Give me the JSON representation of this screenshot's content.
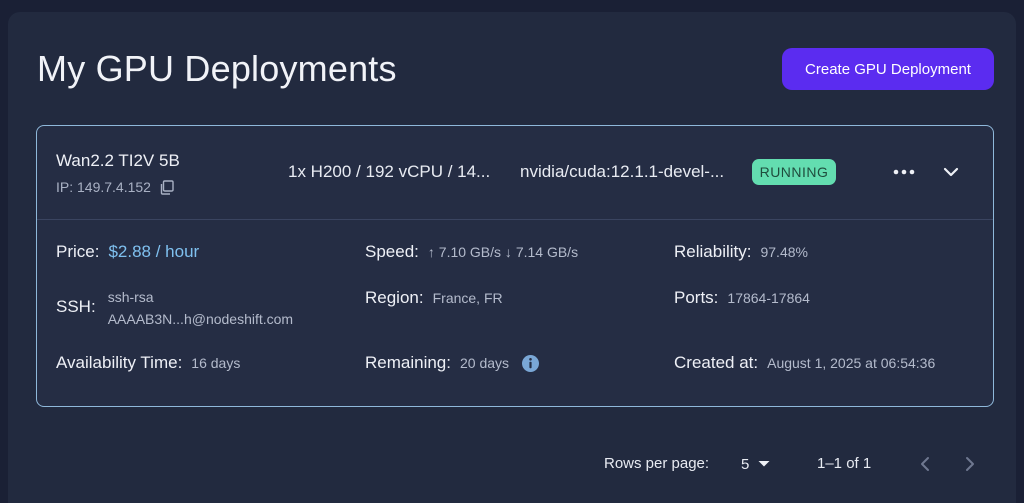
{
  "header": {
    "title": "My GPU Deployments",
    "create_button_label": "Create GPU Deployment"
  },
  "deployment": {
    "name": "Wan2.2 TI2V 5B",
    "ip": "IP: 149.7.4.152",
    "specs": "1x H200 / 192 vCPU / 14...",
    "image": "nvidia/cuda:12.1.1-devel-...",
    "status": "RUNNING",
    "details": {
      "price_label": "Price:",
      "price_value": "$2.88 / hour",
      "speed_label": "Speed:",
      "speed_value": "↑ 7.10 GB/s ↓ 7.14 GB/s",
      "reliability_label": "Reliability:",
      "reliability_value": "97.48%",
      "ssh_label": "SSH:",
      "ssh_line1": "ssh-rsa",
      "ssh_line2": "AAAAB3N...h@nodeshift.com",
      "region_label": "Region:",
      "region_value": "France, FR",
      "ports_label": "Ports:",
      "ports_value": "17864-17864",
      "availability_label": "Availability Time:",
      "availability_value": "16 days",
      "remaining_label": "Remaining:",
      "remaining_value": "20 days",
      "created_label": "Created at:",
      "created_value": "August 1, 2025 at 06:54:36"
    }
  },
  "pagination": {
    "rows_per_page_label": "Rows per page:",
    "rows_per_page_value": "5",
    "range": "1–1 of 1"
  },
  "icons": {
    "copy": "copy-icon",
    "more": "more-horizontal-icon",
    "expand": "chevron-down-icon",
    "info": "info-icon",
    "dropdown": "caret-down-icon",
    "prev": "chevron-left-icon",
    "next": "chevron-right-icon"
  },
  "colors": {
    "background": "#1a2035",
    "panel": "#222a3f",
    "card_border": "#8fb8da",
    "primary_button": "#5b2cf0",
    "status_running": "#63ddb0",
    "price_accent": "#7fc0ef"
  }
}
